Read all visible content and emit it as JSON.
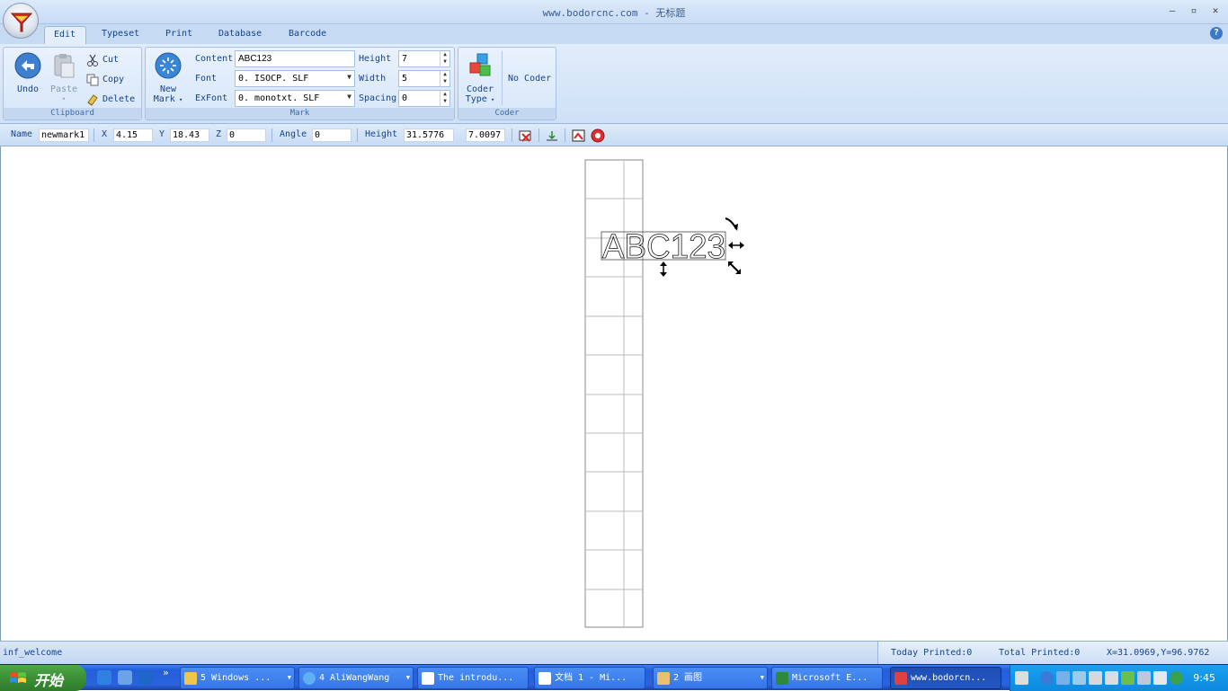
{
  "window": {
    "title": "www.bodorcnc.com - 无标题",
    "minimize": "–",
    "restore": "▫",
    "close": "✕",
    "help": "?"
  },
  "tabs": [
    {
      "label": "Edit",
      "active": true
    },
    {
      "label": "Typeset"
    },
    {
      "label": "Print"
    },
    {
      "label": "Database"
    },
    {
      "label": "Barcode"
    }
  ],
  "ribbon": {
    "clipboard": {
      "group_label": "Clipboard",
      "undo": "Undo",
      "paste": "Paste",
      "cut": "Cut",
      "copy": "Copy",
      "delete": "Delete"
    },
    "mark": {
      "group_label": "Mark",
      "new_mark_line1": "New",
      "new_mark_line2": "Mark",
      "content_label": "Content",
      "content_value": "ABC123",
      "font_label": "Font",
      "font_value": "0. ISOCP. SLF",
      "exfont_label": "ExFont",
      "exfont_value": "0. monotxt. SLF",
      "height_label": "Height",
      "height_value": "7",
      "width_label": "Width",
      "width_value": "5",
      "spacing_label": "Spacing",
      "spacing_value": "0"
    },
    "coder": {
      "group_label": "Coder",
      "coder_type_line1": "Coder",
      "coder_type_line2": "Type",
      "no_coder": "No Coder"
    }
  },
  "propbar": {
    "name_label": "Name",
    "name_value": "newmark1",
    "x_label": "X",
    "x_value": "4.15",
    "y_label": "Y",
    "y_value": "18.43",
    "z_label": "Z",
    "z_value": "0",
    "angle_label": "Angle",
    "angle_value": "0",
    "height_label": "Height",
    "height_value": "31.5776",
    "width_value": "7.0097"
  },
  "canvas": {
    "mark_text": "ABC123"
  },
  "status": {
    "left": "inf_welcome",
    "today": "Today Printed:0",
    "total": "Total Printed:0",
    "coords": "X=31.0969,Y=96.9762"
  },
  "taskbar": {
    "start": "开始",
    "tasks": [
      {
        "label": "5 Windows ..."
      },
      {
        "label": "4 AliWangWang"
      },
      {
        "label": "The introdu..."
      },
      {
        "label": "文档 1 - Mi..."
      },
      {
        "label": "2 画图"
      },
      {
        "label": "Microsoft E..."
      },
      {
        "label": "www.bodorcn..."
      }
    ],
    "clock": "9:45",
    "overflow": "»"
  }
}
